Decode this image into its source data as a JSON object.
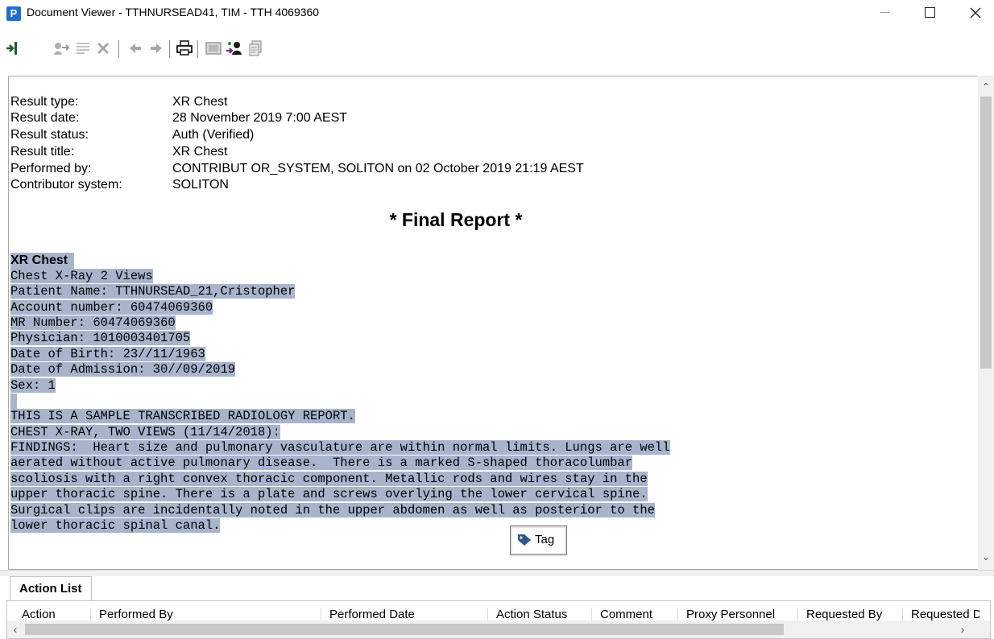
{
  "window": {
    "app_icon_letter": "P",
    "title": "Document Viewer - TTHNURSEAD41, TIM - TTH 4069360"
  },
  "toolbar": {
    "icons": [
      "exit-icon",
      "forward-route-icon",
      "notes-icon",
      "delete-icon",
      "previous-icon",
      "next-icon",
      "print-icon",
      "preview-icon",
      "assign-icon",
      "copy-icon"
    ]
  },
  "result": {
    "fields": [
      {
        "label": "Result type:",
        "value": "XR Chest"
      },
      {
        "label": "Result date:",
        "value": "28 November 2019 7:00 AEST"
      },
      {
        "label": "Result status:",
        "value": "Auth (Verified)"
      },
      {
        "label": "Result title:",
        "value": "XR Chest"
      },
      {
        "label": "Performed by:",
        "value": "CONTRIBUT OR_SYSTEM, SOLITON on 02 October 2019 21:19 AEST"
      },
      {
        "label": "Contributor system:",
        "value": "SOLITON"
      }
    ],
    "final_report_heading": "* Final Report *",
    "report_title": "XR Chest",
    "report_lines": [
      "Chest X-Ray 2 Views",
      "Patient Name: TTHNURSEAD_21,Cristopher",
      "Account number: 60474069360",
      "MR Number: 60474069360",
      "Physician: 1010003401705",
      "Date of Birth: 23//11/1963",
      "Date of Admission: 30//09/2019",
      "Sex: 1",
      "",
      "THIS IS A SAMPLE TRANSCRIBED RADIOLOGY REPORT.",
      "CHEST X-RAY, TWO VIEWS (11/14/2018):",
      "FINDINGS:  Heart size and pulmonary vasculature are within normal limits. Lungs are well",
      "aerated without active pulmonary disease.  There is a marked S-shaped thoracolumbar",
      "scoliosis with a right convex thoracic component. Metallic rods and wires stay in the",
      "upper thoracic spine. There is a plate and screws overlying the lower cervical spine.",
      "Surgical clips are incidentally noted in the upper abdomen as well as posterior to the",
      "lower thoracic spinal canal."
    ],
    "tag_button_label": "Tag"
  },
  "action_list": {
    "tab_label": "Action List",
    "columns": [
      "Action",
      "Performed By",
      "Performed Date",
      "Action Status",
      "Comment",
      "Proxy Personnel",
      "Requested By",
      "Requested Date"
    ]
  },
  "colors": {
    "selection": "#a7b4cc",
    "app_icon": "#1f6fd1"
  }
}
